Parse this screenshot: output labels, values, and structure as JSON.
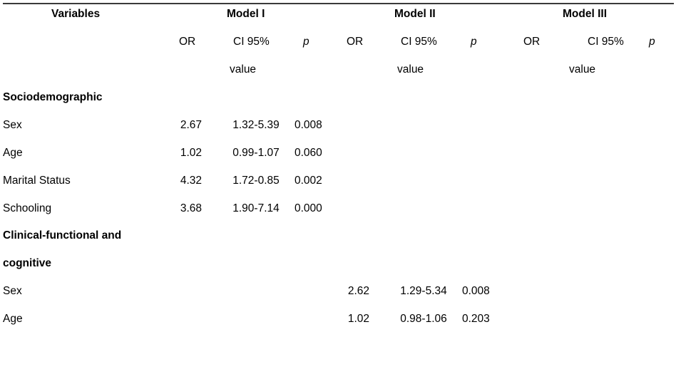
{
  "table": {
    "header": {
      "variables_label": "Variables",
      "models": [
        {
          "name": "Model I"
        },
        {
          "name": "Model II"
        },
        {
          "name": "Model III"
        }
      ],
      "subcolumns": [
        "OR",
        "CI 95%",
        "p"
      ],
      "p_value_continuation": "value"
    },
    "sections": [
      {
        "title": "Sociodemographic",
        "rows": [
          {
            "variable": "Sex",
            "model_1": {
              "or": "2.67",
              "ci": "1.32-5.39",
              "p": "0.008"
            },
            "model_2": {
              "or": "",
              "ci": "",
              "p": ""
            },
            "model_3": {
              "or": "",
              "ci": "",
              "p": ""
            }
          },
          {
            "variable": "Age",
            "model_1": {
              "or": "1.02",
              "ci": "0.99-1.07",
              "p": "0.060"
            },
            "model_2": {
              "or": "",
              "ci": "",
              "p": ""
            },
            "model_3": {
              "or": "",
              "ci": "",
              "p": ""
            }
          },
          {
            "variable": "Marital Status",
            "model_1": {
              "or": "4.32",
              "ci": "1.72-0.85",
              "p": "0.002"
            },
            "model_2": {
              "or": "",
              "ci": "",
              "p": ""
            },
            "model_3": {
              "or": "",
              "ci": "",
              "p": ""
            }
          },
          {
            "variable": "Schooling",
            "model_1": {
              "or": "3.68",
              "ci": "1.90-7.14",
              "p": "0.000"
            },
            "model_2": {
              "or": "",
              "ci": "",
              "p": ""
            },
            "model_3": {
              "or": "",
              "ci": "",
              "p": ""
            }
          }
        ]
      },
      {
        "title_line_1": "Clinical-functional and",
        "title_line_2": "cognitive",
        "rows": [
          {
            "variable": "Sex",
            "model_1": {
              "or": "",
              "ci": "",
              "p": ""
            },
            "model_2": {
              "or": "2.62",
              "ci": "1.29-5.34",
              "p": "0.008"
            },
            "model_3": {
              "or": "",
              "ci": "",
              "p": ""
            }
          },
          {
            "variable": "Age",
            "model_1": {
              "or": "",
              "ci": "",
              "p": ""
            },
            "model_2": {
              "or": "1.02",
              "ci": "0.98-1.06",
              "p": "0.203"
            },
            "model_3": {
              "or": "",
              "ci": "",
              "p": ""
            }
          }
        ]
      }
    ]
  }
}
